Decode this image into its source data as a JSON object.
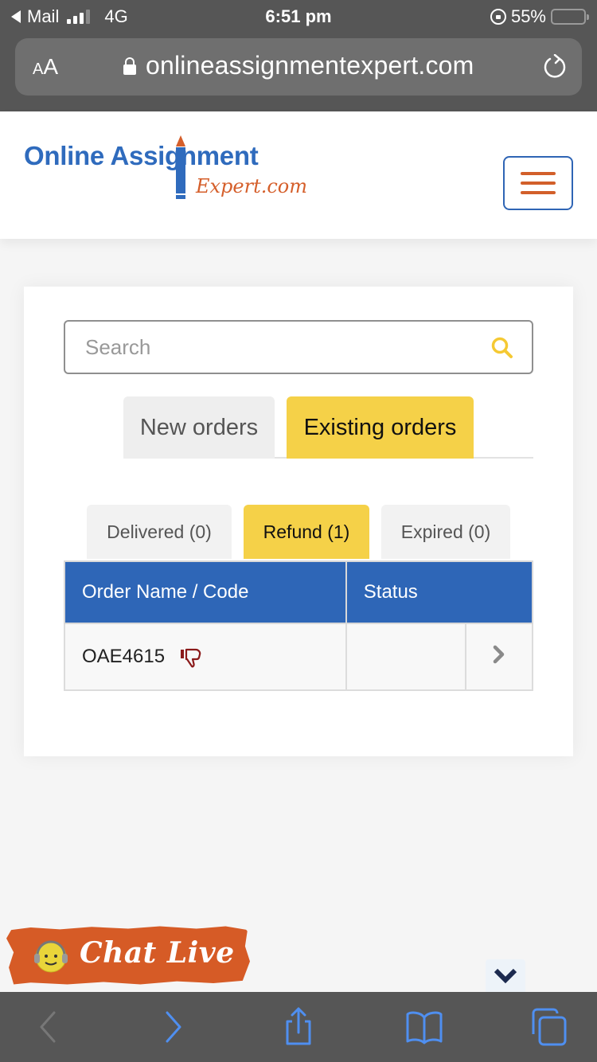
{
  "status_bar": {
    "back_app": "Mail",
    "network": "4G",
    "time": "6:51 pm",
    "battery": "55%",
    "battery_level": 0.55
  },
  "browser": {
    "text_size_label": "AA",
    "url": "onlineassignmentexpert.com"
  },
  "site": {
    "logo_main": "Online Assignment",
    "logo_sub": "Expert.com",
    "brand_blue": "#2f6bbd",
    "brand_orange": "#d55f2b"
  },
  "search": {
    "placeholder": "Search",
    "value": ""
  },
  "main_tabs": [
    {
      "label": "New orders",
      "active": false
    },
    {
      "label": "Existing orders",
      "active": true
    }
  ],
  "sub_tabs": [
    {
      "label": "Delivered (0)",
      "active": false
    },
    {
      "label": "Refund (1)",
      "active": true
    },
    {
      "label": "Expired (0)",
      "active": false
    }
  ],
  "table": {
    "columns": [
      "Order Name / Code",
      "Status"
    ],
    "rows": [
      {
        "code": "OAE4615",
        "status": "",
        "icon": "thumbs-down-icon"
      }
    ]
  },
  "chat": {
    "label": "Chat Live"
  },
  "accent_colors": {
    "active_tab": "#f5d148",
    "table_header": "#2e66b7",
    "toolbar_icon": "#4f8ff0"
  }
}
